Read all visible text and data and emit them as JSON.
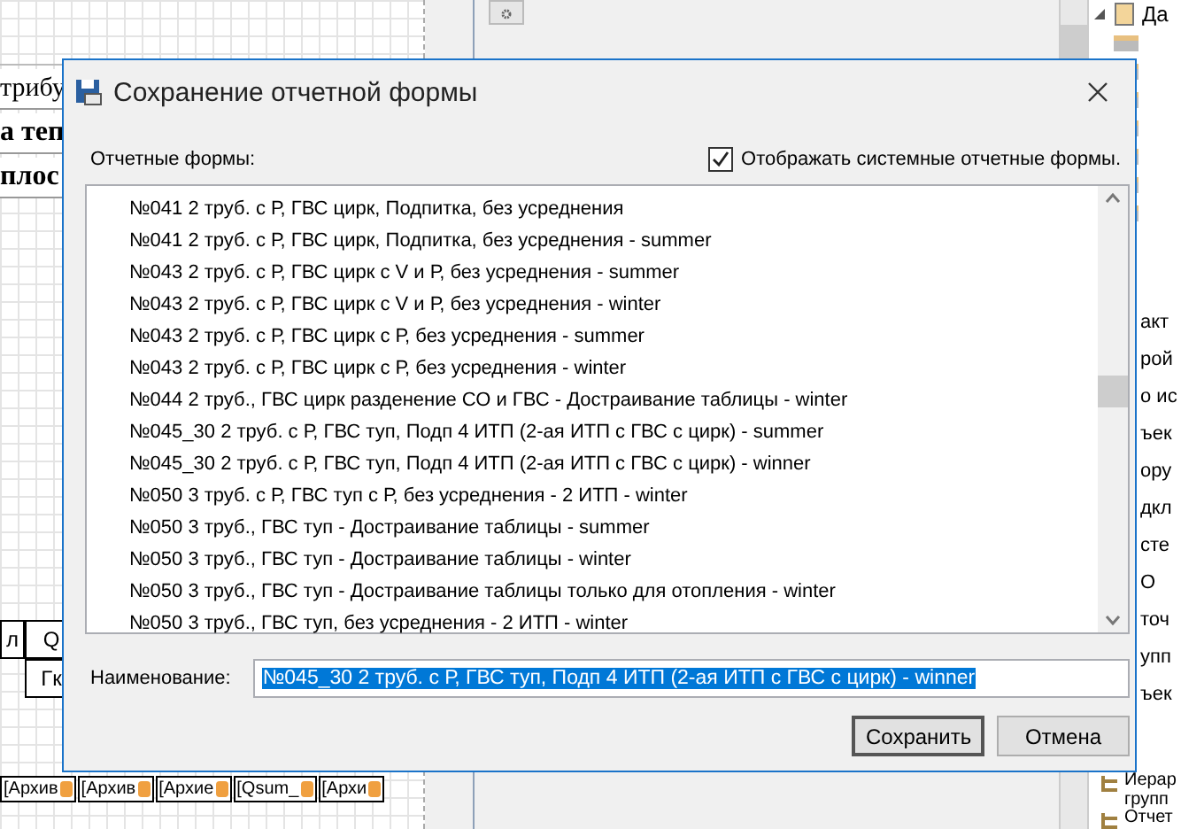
{
  "background": {
    "designer_texts": [
      {
        "text": "трибу",
        "kind": "plain"
      },
      {
        "text": "а теп",
        "kind": "bold"
      },
      {
        "text": "плос",
        "kind": "bold"
      }
    ],
    "table_rows": [
      [
        "л",
        "Q"
      ],
      [
        "Гк"
      ]
    ],
    "bottom_tabs": [
      "[Архив",
      "[Архив",
      "[Архие",
      "[Qsum_",
      "[Архи"
    ],
    "tree_top": "Да",
    "panel_texts": [
      "акт",
      "рой",
      "о ис",
      "ъек",
      "ору",
      "дкл",
      "сте",
      "О",
      "точ",
      "упп",
      "ъек"
    ],
    "tree_bottom": [
      {
        "lines": [
          "Иерар",
          "групп"
        ]
      },
      {
        "lines": [
          "Отчет"
        ]
      }
    ]
  },
  "dialog": {
    "title": "Сохранение отчетной формы",
    "list_label": "Отчетные формы:",
    "show_system": {
      "label": "Отображать системные отчетные формы.",
      "checked": true
    },
    "forms": [
      {
        "text": "№041 2 труб. с Р, ГВС цирк, Подпитка, без усреднения",
        "selected": false
      },
      {
        "text": "№041 2 труб. с Р, ГВС цирк, Подпитка, без усреднения - summer",
        "selected": false
      },
      {
        "text": "№043 2 труб. с Р, ГВС цирк с V и Р, без усреднения - summer",
        "selected": false
      },
      {
        "text": "№043 2 труб. с Р, ГВС цирк с V и Р, без усреднения - winter",
        "selected": false
      },
      {
        "text": "№043 2 труб. с Р, ГВС цирк с Р, без усреднения - summer",
        "selected": false
      },
      {
        "text": "№043 2 труб. с Р, ГВС цирк с Р, без усреднения - winter",
        "selected": false
      },
      {
        "text": "№044 2 труб., ГВС цирк разденение СО и ГВС - Достраивание таблицы - winter",
        "selected": false
      },
      {
        "text": "№045_30 2 труб. с Р, ГВС туп, Подп 4 ИТП (2-ая ИТП с ГВС с цирк) - summer",
        "selected": false
      },
      {
        "text": "№045_30 2 труб. с Р, ГВС туп, Подп 4 ИТП (2-ая ИТП с ГВС с цирк) - winner",
        "selected": false
      },
      {
        "text": "№050 3 труб. с Р, ГВС туп с Р, без усреднения -  2 ИТП - winter",
        "selected": false
      },
      {
        "text": "№050 3 труб., ГВС туп - Достраивание таблицы - summer",
        "selected": false
      },
      {
        "text": "№050 3 труб., ГВС туп - Достраивание таблицы - winter",
        "selected": false
      },
      {
        "text": "№050 3 труб., ГВС туп - Достраивание таблицы только для отопления - winter",
        "selected": false
      },
      {
        "text": "№050 3 труб., ГВС туп, без усреднения -  2 ИТП - winter",
        "selected": false
      }
    ],
    "name_label": "Наименование:",
    "name_value": "№045_30 2 труб. с Р, ГВС туп, Подп 4 ИТП (2-ая ИТП с ГВС с цирк) - winner",
    "name_value_selected": true,
    "buttons": [
      {
        "label": "Сохранить",
        "default": true
      },
      {
        "label": "Отмена",
        "default": false
      }
    ]
  }
}
